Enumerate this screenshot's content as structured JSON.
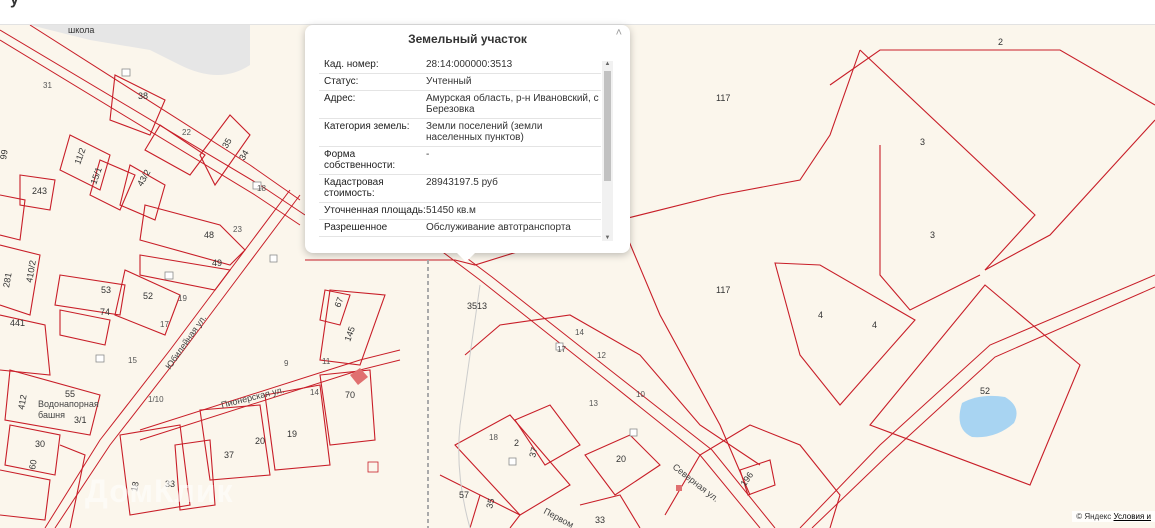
{
  "header": {
    "title": "у"
  },
  "popup": {
    "title": "Земельный участок",
    "close_glyph": "˄",
    "rows": [
      {
        "key": "Кад. номер:",
        "value": "28:14:000000:3513"
      },
      {
        "key": "Статус:",
        "value": "Учтенный"
      },
      {
        "key": "Адрес:",
        "value": "Амурская область, р-н Ивановский, с Березовка"
      },
      {
        "key": "Категория земель:",
        "value": "Земли поселений (земли населенных пунктов)"
      },
      {
        "key": "Форма собственности:",
        "value": "-"
      },
      {
        "key": "Кадастровая стоимость:",
        "value": "28943197.5 руб"
      },
      {
        "key": "Уточненная площадь:",
        "value": "51450 кв.м"
      },
      {
        "key": "Разрешенное",
        "value": "Обслуживание автотранспорта"
      }
    ]
  },
  "map": {
    "labels": {
      "school": "школа",
      "parcel_main": "3513",
      "p2": "2",
      "p3a": "3",
      "p3b": "3",
      "p117a": "117",
      "p117b": "117",
      "p117c": "117",
      "p117d": "117",
      "p4a": "4",
      "p4b": "4",
      "p52": "52",
      "p38": "38",
      "p35": "35",
      "p34": "34",
      "p22": "22",
      "p11_2": "11/2",
      "p15_1": "15/1",
      "p43_2": "43/2",
      "p243": "243",
      "p18": "18",
      "p48": "48",
      "p23": "23",
      "p49": "49",
      "p410_2": "410/2",
      "p281": "281",
      "p441": "441",
      "p53": "53",
      "p52b": "52",
      "p74": "74",
      "p19": "19",
      "p17": "17",
      "p15": "15",
      "p67": "67",
      "p145": "145",
      "p11": "11",
      "p9": "9",
      "p14": "14",
      "p70": "70",
      "p55": "55",
      "p3_1": "3/1",
      "p1_10": "1/10",
      "p37": "37",
      "p20": "20",
      "p19b": "19",
      "p30": "30",
      "p60": "60",
      "p18b": "18",
      "p33": "33",
      "p57": "57",
      "p35b": "35",
      "p33b": "33",
      "p2b": "2",
      "p37b": "37",
      "p18c": "18",
      "p20b": "20",
      "p196": "196",
      "p14b": "14",
      "p12": "12",
      "p13": "13",
      "p10": "10",
      "p17b": "17",
      "p31": "31",
      "p99": "99",
      "p412": "412"
    },
    "streets": {
      "yubileynaya": "Юбилейная ул.",
      "pionerskaya": "Пионерская ул.",
      "severnaya": "Северная ул.",
      "pervomayskaya": "Первом",
      "water_tower": "башня",
      "water_tower_top": "Водонапорная"
    },
    "watermark": "ДомКлик",
    "credits": {
      "copyright": "© Яндекс",
      "terms": "Условия и"
    },
    "colors": {
      "boundary": "#c81e28",
      "background": "#fbf6ec",
      "water": "#a8d4f2"
    }
  }
}
